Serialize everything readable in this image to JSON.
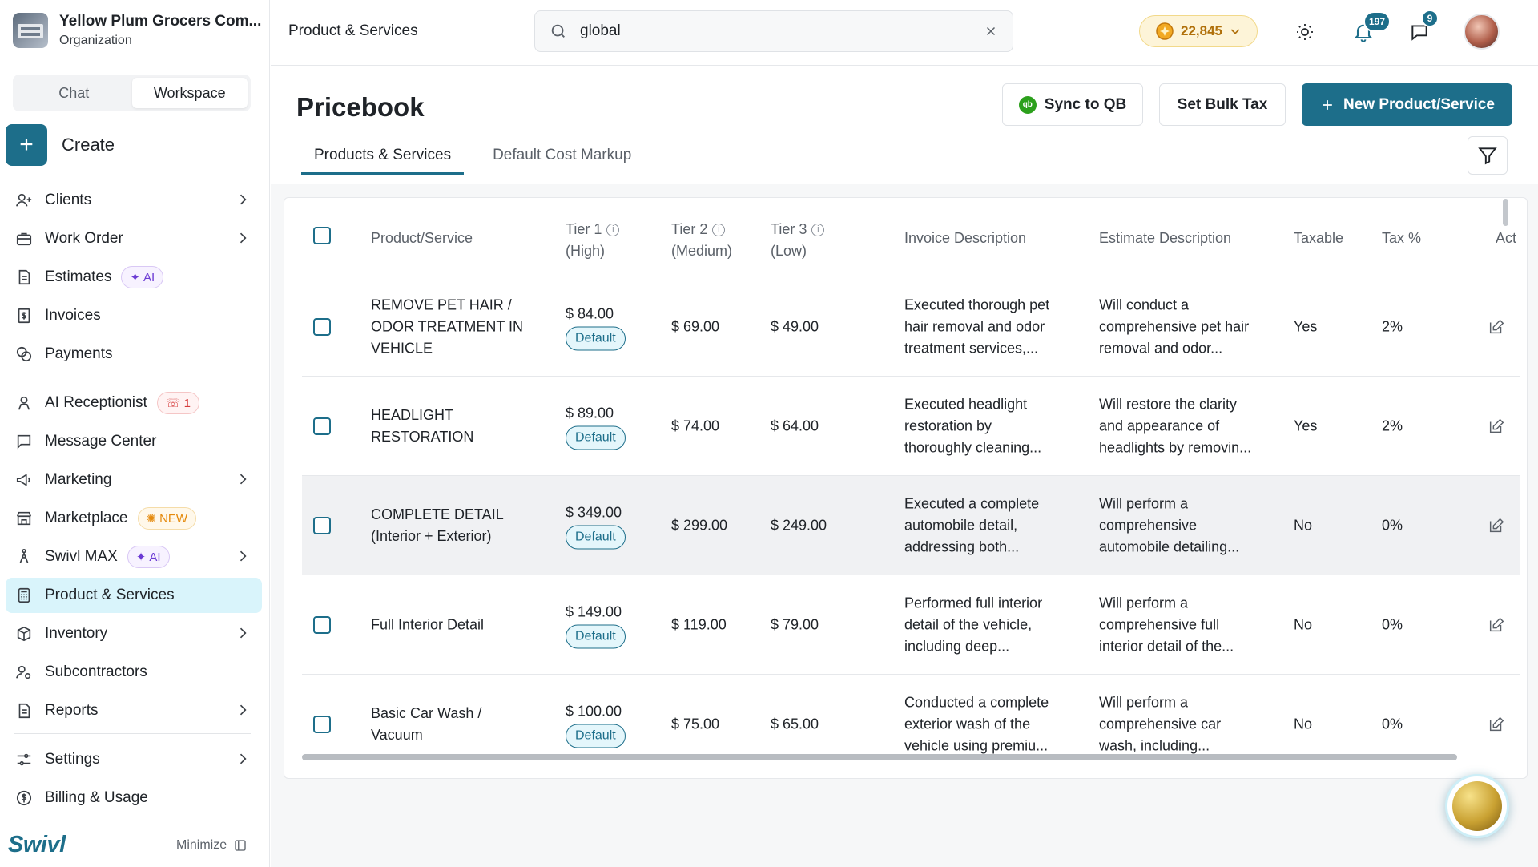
{
  "org": {
    "name": "Yellow Plum Grocers Com...",
    "subtitle": "Organization"
  },
  "mode_toggle": {
    "chat": "Chat",
    "workspace": "Workspace"
  },
  "create_label": "Create",
  "nav": {
    "clients": "Clients",
    "work_order": "Work Order",
    "estimates": "Estimates",
    "estimates_badge": "AI",
    "invoices": "Invoices",
    "payments": "Payments",
    "ai_receptionist": "AI Receptionist",
    "ai_receptionist_badge": "1",
    "message_center": "Message Center",
    "marketing": "Marketing",
    "marketplace": "Marketplace",
    "marketplace_badge": "NEW",
    "swivl_max": "Swivl MAX",
    "swivl_max_badge": "AI",
    "product_services": "Product & Services",
    "inventory": "Inventory",
    "subcontractors": "Subcontractors",
    "reports": "Reports",
    "settings": "Settings",
    "billing": "Billing & Usage"
  },
  "brand": "Swivl",
  "minimize_label": "Minimize",
  "topbar": {
    "breadcrumb": "Product & Services",
    "search_value": "global",
    "coins": "22,845",
    "notifications_count": "197",
    "messages_count": "9"
  },
  "page": {
    "title": "Pricebook",
    "sync_button": "Sync to QB",
    "bulk_tax_button": "Set Bulk Tax",
    "new_button": "New Product/Service",
    "tabs": [
      "Products & Services",
      "Default Cost Markup"
    ]
  },
  "table": {
    "headers": {
      "product": "Product/Service",
      "tier1": "Tier 1",
      "tier1_sub": "(High)",
      "tier2": "Tier 2",
      "tier2_sub": "(Medium)",
      "tier3": "Tier 3",
      "tier3_sub": "(Low)",
      "invoice_desc": "Invoice Description",
      "estimate_desc": "Estimate Description",
      "taxable": "Taxable",
      "tax_pct": "Tax %",
      "actions": "Act"
    },
    "default_tag": "Default",
    "rows": [
      {
        "name_l1": "REMOVE PET HAIR /",
        "name_l2": "ODOR TREATMENT IN",
        "name_l3": "VEHICLE",
        "tier1": "$ 84.00",
        "tier2": "$ 69.00",
        "tier3": "$ 49.00",
        "inv_l1": "Executed thorough pet",
        "inv_l2": "hair removal and odor",
        "inv_l3": "treatment services,...",
        "est_l1": "Will conduct a",
        "est_l2": "comprehensive pet hair",
        "est_l3": "removal and odor...",
        "taxable": "Yes",
        "tax": "2%"
      },
      {
        "name_l1": "HEADLIGHT",
        "name_l2": "RESTORATION",
        "name_l3": "",
        "tier1": "$ 89.00",
        "tier2": "$ 74.00",
        "tier3": "$ 64.00",
        "inv_l1": "Executed headlight",
        "inv_l2": "restoration by",
        "inv_l3": "thoroughly cleaning...",
        "est_l1": "Will restore the clarity",
        "est_l2": "and appearance of",
        "est_l3": "headlights by removin...",
        "taxable": "Yes",
        "tax": "2%"
      },
      {
        "name_l1": "COMPLETE DETAIL",
        "name_l2": "(Interior + Exterior)",
        "name_l3": "",
        "tier1": "$ 349.00",
        "tier2": "$ 299.00",
        "tier3": "$ 249.00",
        "inv_l1": "Executed a complete",
        "inv_l2": "automobile detail,",
        "inv_l3": "addressing both...",
        "est_l1": "Will perform a",
        "est_l2": "comprehensive",
        "est_l3": "automobile detailing...",
        "taxable": "No",
        "tax": "0%"
      },
      {
        "name_l1": "Full Interior Detail",
        "name_l2": "",
        "name_l3": "",
        "tier1": "$ 149.00",
        "tier2": "$ 119.00",
        "tier3": "$ 79.00",
        "inv_l1": "Performed full interior",
        "inv_l2": "detail of the vehicle,",
        "inv_l3": "including deep...",
        "est_l1": "Will perform a",
        "est_l2": "comprehensive full",
        "est_l3": "interior detail of the...",
        "taxable": "No",
        "tax": "0%"
      },
      {
        "name_l1": "Basic Car Wash /",
        "name_l2": "Vacuum",
        "name_l3": "",
        "tier1": "$ 100.00",
        "tier2": "$ 75.00",
        "tier3": "$ 65.00",
        "inv_l1": "Conducted a complete",
        "inv_l2": "exterior wash of the",
        "inv_l3": "vehicle using premiu...",
        "est_l1": "Will perform a",
        "est_l2": "comprehensive car",
        "est_l3": "wash, including...",
        "taxable": "No",
        "tax": "0%"
      }
    ]
  },
  "colors": {
    "accent": "#1d6e8a",
    "active_nav": "#d9f4fb",
    "coin": "#b0700a"
  }
}
